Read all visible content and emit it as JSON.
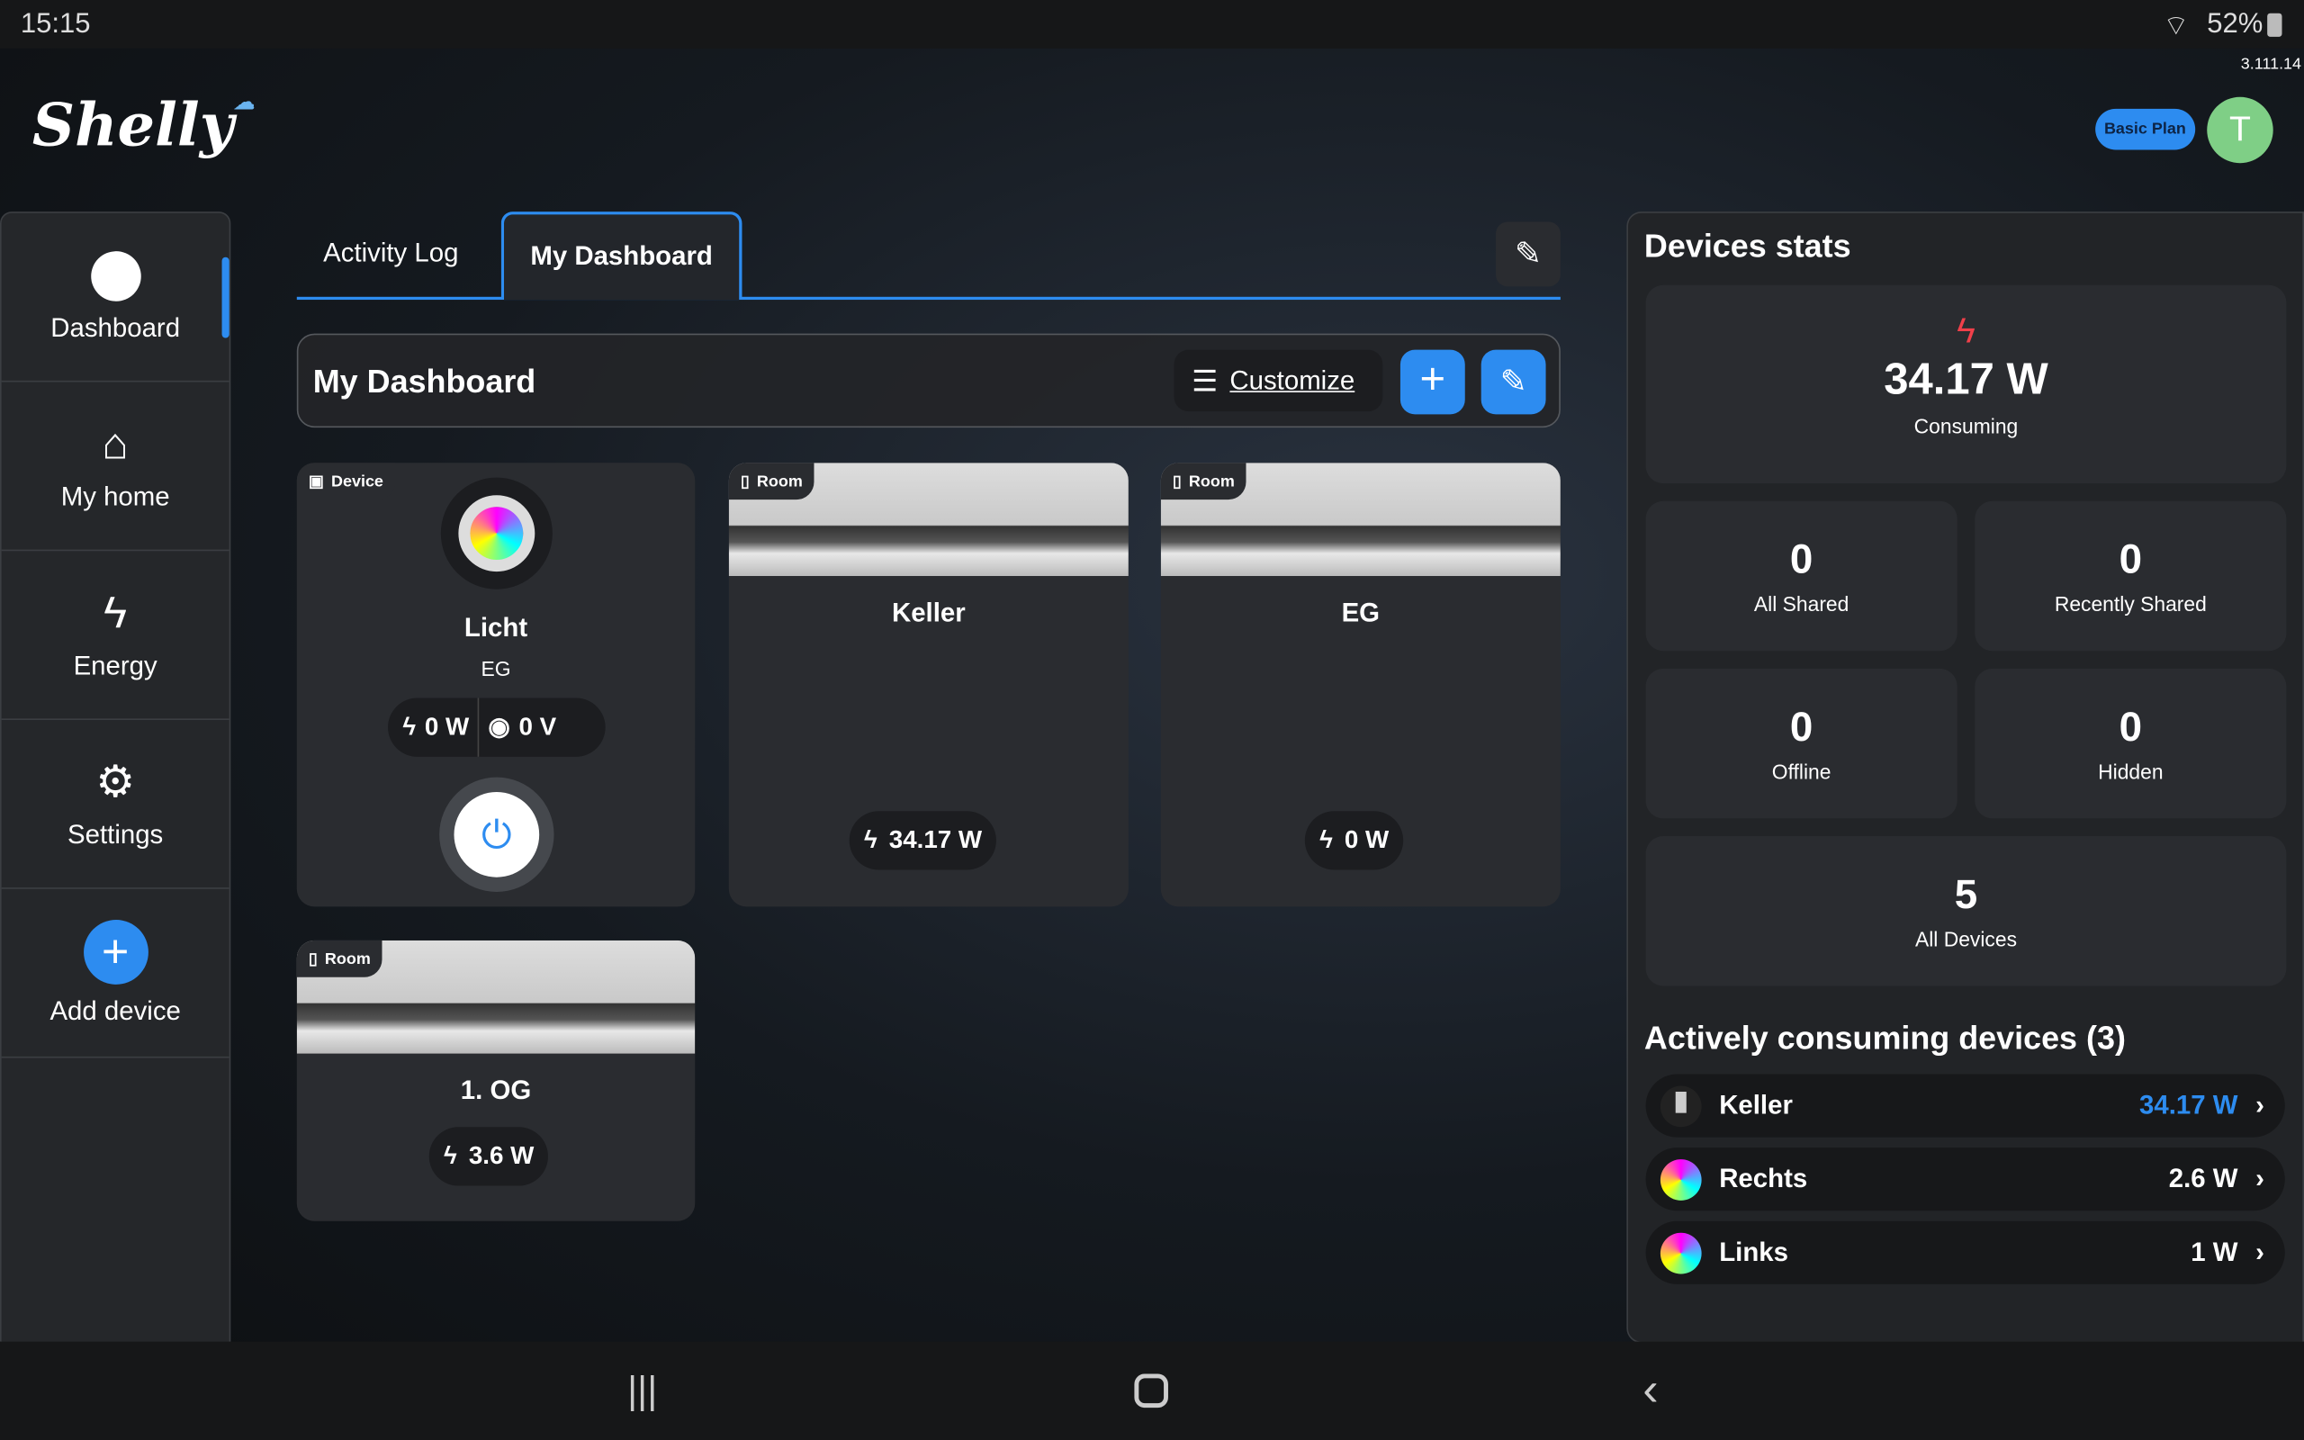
{
  "status": {
    "time": "15:15",
    "battery": "52%",
    "version": "3.111.14"
  },
  "brand": {
    "logo": "Shelly"
  },
  "header": {
    "plan": "Basic Plan",
    "avatar": "T",
    "avatar_color": "#7fcf86",
    "accent": "#2d8cf0"
  },
  "sidebar": {
    "items": [
      {
        "label": "Dashboard",
        "icon": "palette-icon"
      },
      {
        "label": "My home",
        "icon": "home-icon"
      },
      {
        "label": "Energy",
        "icon": "bolt-icon"
      },
      {
        "label": "Settings",
        "icon": "gear-icon"
      },
      {
        "label": "Add device",
        "icon": "plus-icon"
      }
    ]
  },
  "tabs": [
    {
      "label": "Activity Log"
    },
    {
      "label": "My Dashboard",
      "active": true
    }
  ],
  "dashboard": {
    "title": "My Dashboard",
    "customize": "Customize"
  },
  "cards": [
    {
      "badge": "Device",
      "name": "Licht",
      "room": "EG",
      "power": "0 W",
      "voltage": "0 V"
    },
    {
      "badge": "Room",
      "name": "Keller",
      "power": "34.17 W"
    },
    {
      "badge": "Room",
      "name": "EG",
      "power": "0 W"
    },
    {
      "badge": "Room",
      "name": "1. OG",
      "power": "3.6 W"
    }
  ],
  "stats": {
    "title": "Devices stats",
    "consuming_value": "34.17 W",
    "consuming_label": "Consuming",
    "tiles": [
      {
        "n": "0",
        "l": "All Shared"
      },
      {
        "n": "0",
        "l": "Recently Shared"
      },
      {
        "n": "0",
        "l": "Offline"
      },
      {
        "n": "0",
        "l": "Hidden"
      },
      {
        "n": "5",
        "l": "All Devices"
      }
    ]
  },
  "active": {
    "title": "Actively consuming devices (3)",
    "items": [
      {
        "name": "Keller",
        "value": "34.17 W"
      },
      {
        "name": "Rechts",
        "value": "2.6 W"
      },
      {
        "name": "Links",
        "value": "1 W"
      }
    ]
  }
}
